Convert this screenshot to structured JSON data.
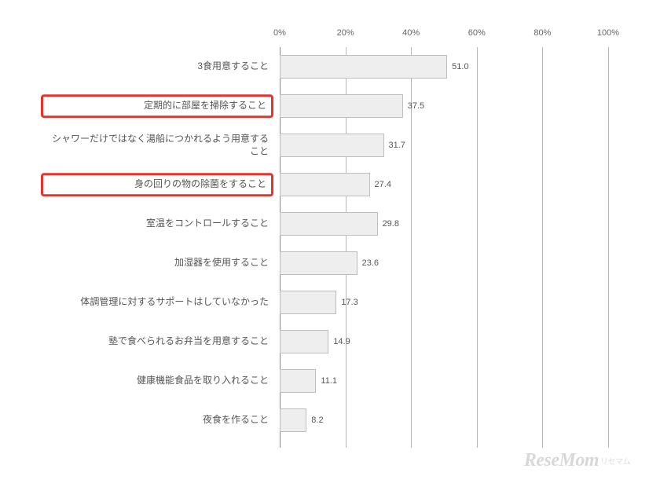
{
  "chart_data": {
    "type": "bar",
    "orientation": "horizontal",
    "xlabel": "",
    "ylabel": "",
    "xlim": [
      0,
      100
    ],
    "ticks": [
      0,
      20,
      40,
      60,
      80,
      100
    ],
    "tick_labels": [
      "0%",
      "20%",
      "40%",
      "60%",
      "80%",
      "100%"
    ],
    "categories": [
      "3食用意すること",
      "定期的に部屋を掃除すること",
      "シャワーだけではなく湯船につかれるよう用意すること",
      "身の回りの物の除菌をすること",
      "室温をコントロールすること",
      "加湿器を使用すること",
      "体調管理に対するサポートはしていなかった",
      "塾で食べられるお弁当を用意すること",
      "健康機能食品を取り入れること",
      "夜食を作ること"
    ],
    "values": [
      51.0,
      37.5,
      31.7,
      27.4,
      29.8,
      23.6,
      17.3,
      14.9,
      11.1,
      8.2
    ],
    "highlight": [
      false,
      true,
      false,
      true,
      false,
      false,
      false,
      false,
      false,
      false
    ]
  },
  "watermark": {
    "main": "ReseMom",
    "sub": "リセマム"
  }
}
